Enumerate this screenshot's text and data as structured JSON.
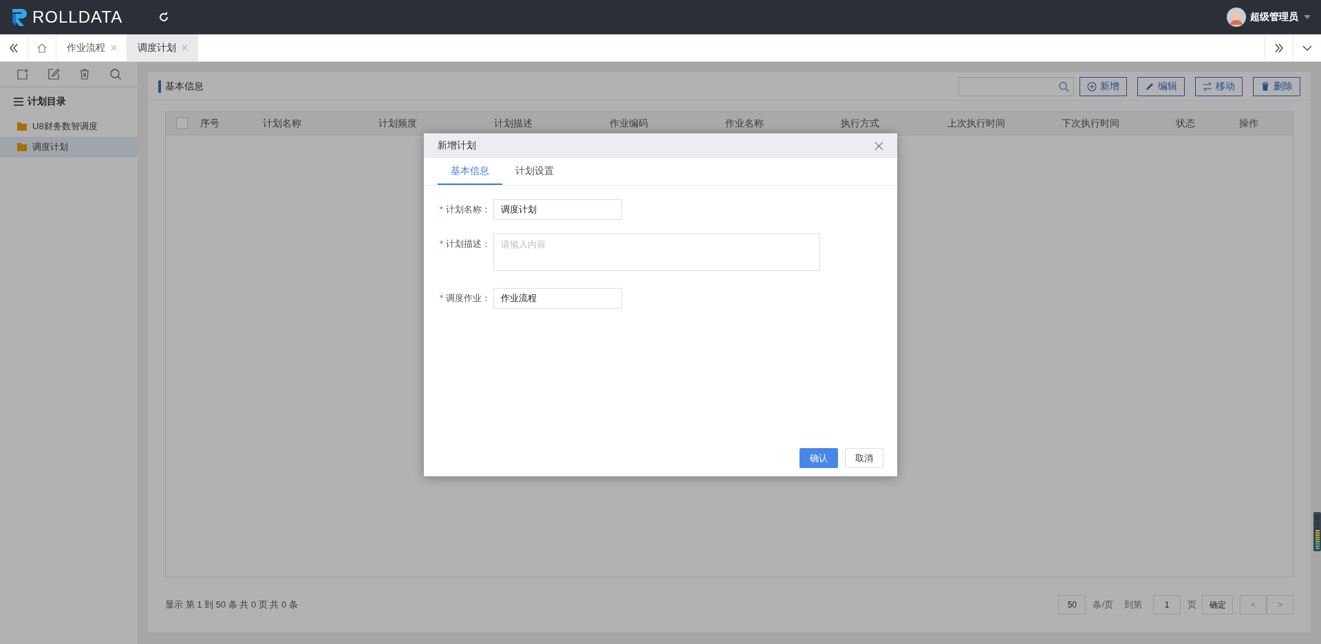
{
  "top_bar": {
    "logo_text": "ROLLDATA",
    "user": "超级管理员"
  },
  "tabs": [
    {
      "label": "作业流程",
      "selected": false
    },
    {
      "label": "调度计划",
      "selected": true
    }
  ],
  "sidebar": {
    "title": "计划目录",
    "items": [
      {
        "label": "U8财务数智调度",
        "selected": false
      },
      {
        "label": "调度计划",
        "selected": true
      }
    ]
  },
  "panel": {
    "title": "基本信息",
    "buttons": [
      {
        "label": "新增",
        "kind": "add"
      },
      {
        "label": "编辑",
        "kind": "edit"
      },
      {
        "label": "移动",
        "kind": "move"
      },
      {
        "label": "删除",
        "kind": "delete"
      }
    ]
  },
  "table": {
    "select_all_checked": false,
    "columns": [
      "序号",
      "计划名称",
      "计划频度",
      "计划描述",
      "作业编码",
      "作业名称",
      "执行方式",
      "上次执行时间",
      "下次执行时间",
      "状态",
      "操作"
    ]
  },
  "pagination": {
    "summary": "显示 第 1 到 50 条 共 0 页 共 0 条",
    "page_size": "50",
    "page_size_unit": "条/页",
    "goto_label": "到第",
    "page": "1",
    "page_unit": "页",
    "go_button": "确定",
    "prev": "<",
    "next": ">"
  },
  "dialog": {
    "title": "新增计划",
    "tabs": [
      {
        "label": "基本信息",
        "selected": true
      },
      {
        "label": "计划设置",
        "selected": false
      }
    ],
    "fields": [
      {
        "label": "计划名称：",
        "required_mark": "*",
        "kind": "input",
        "value": "调度计划"
      },
      {
        "label": "计划描述：",
        "required_mark": "*",
        "kind": "textarea",
        "placeholder": "请输入内容"
      },
      {
        "label": "调度作业：",
        "required_mark": "*",
        "kind": "input",
        "value": "作业流程"
      }
    ],
    "buttons": [
      {
        "label": "确认",
        "kind": "primary"
      },
      {
        "label": "取消",
        "kind": "default"
      }
    ]
  }
}
